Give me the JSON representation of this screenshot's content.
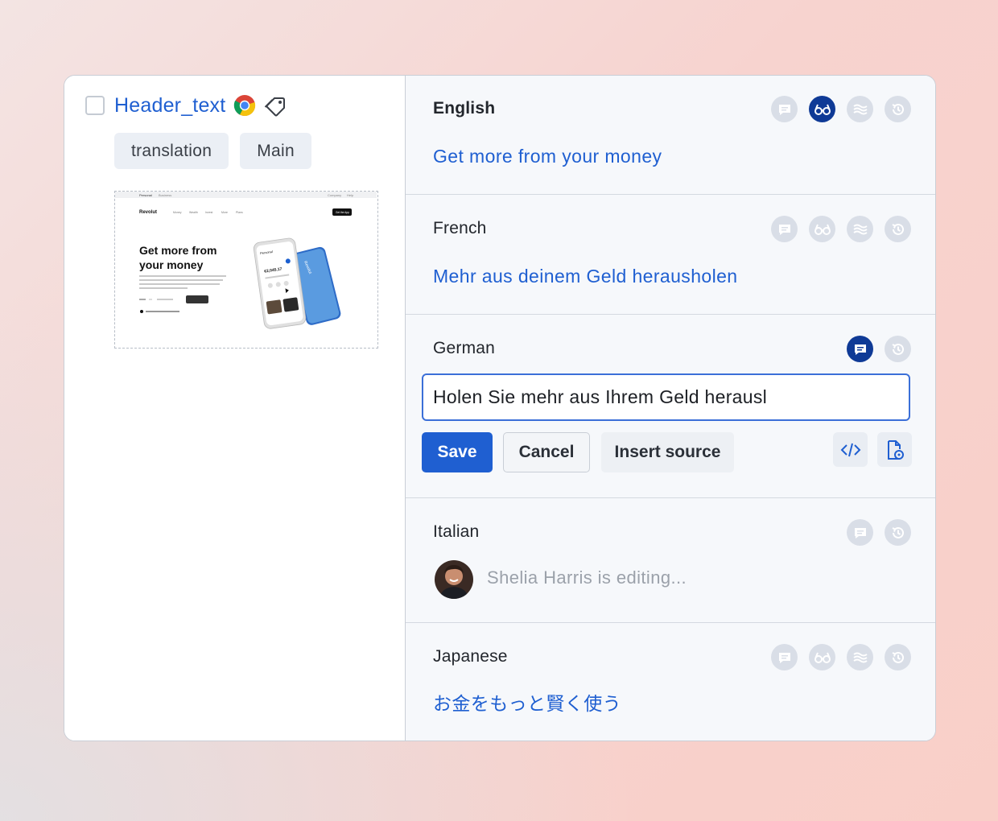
{
  "key": {
    "name": "Header_text",
    "tags": [
      "translation",
      "Main"
    ]
  },
  "preview": {
    "nav_tabs": [
      "Personal",
      "Business"
    ],
    "nav_right": [
      "Company",
      "Help"
    ],
    "brand": "Revolut",
    "menu": [
      "Money",
      "Wealth",
      "Invest",
      "More",
      "Plans"
    ],
    "cta": "Get the App",
    "headline_line1": "Get more from",
    "headline_line2": "your money",
    "phone_label": "Personal",
    "phone_amount": "€2,045.17",
    "card_label": "Revolut"
  },
  "languages": {
    "english": {
      "name": "English",
      "text": "Get more from your money"
    },
    "french": {
      "name": "French",
      "text": "Mehr aus deinem Geld herausholen"
    },
    "german": {
      "name": "German",
      "input_value": "Holen Sie mehr aus Ihrem Geld herausl",
      "save_label": "Save",
      "cancel_label": "Cancel",
      "insert_label": "Insert source"
    },
    "italian": {
      "name": "Italian",
      "editing_text": "Shelia Harris is editing..."
    },
    "japanese": {
      "name": "Japanese",
      "text": "お金をもっと賢く使う"
    }
  },
  "icons": [
    "comment-icon",
    "glasses-icon",
    "waves-icon",
    "history-icon",
    "code-icon",
    "file-settings-icon",
    "chrome-icon",
    "tag-icon"
  ],
  "colors": {
    "accent": "#1f5fd1",
    "active_icon": "#0f3a96",
    "inactive_icon": "#d9dee7"
  }
}
